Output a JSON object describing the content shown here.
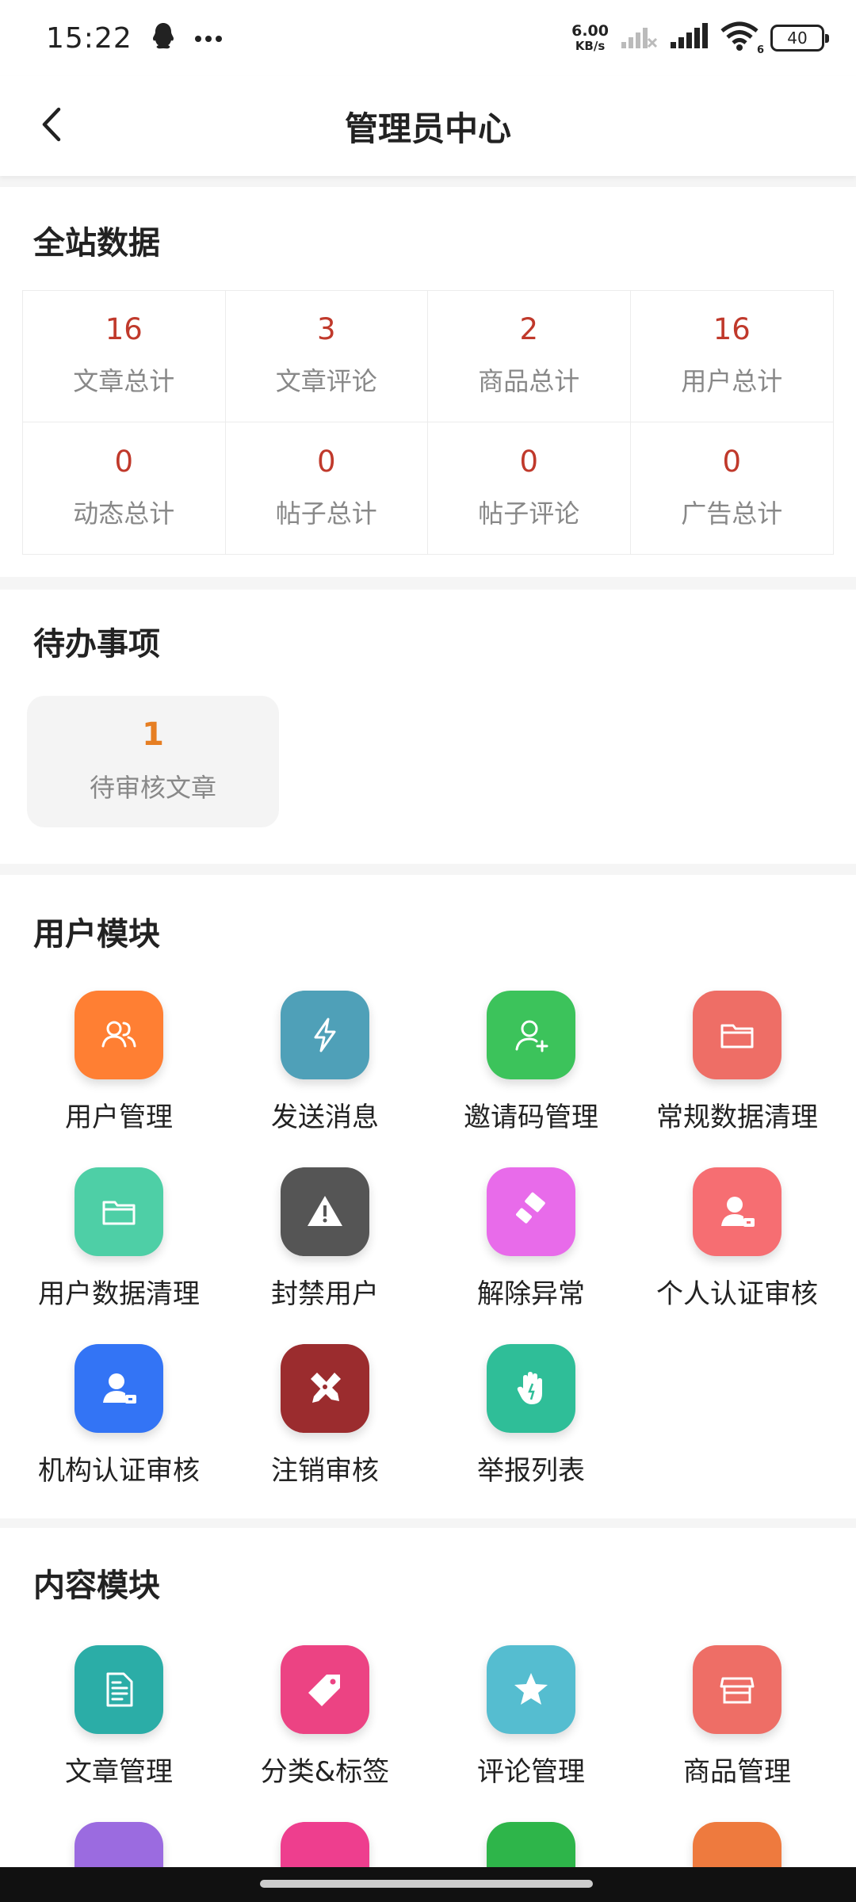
{
  "status_bar": {
    "time": "15:22",
    "net_speed_value": "6.00",
    "net_speed_unit": "KB/s",
    "signal_badge": "6",
    "battery": "40",
    "icons": [
      "qq-icon",
      "more-dots-icon",
      "signal-off-icon",
      "signal-icon",
      "wifi-icon",
      "battery-icon"
    ]
  },
  "nav": {
    "title": "管理员中心",
    "back_icon": "chevron-left-icon"
  },
  "site_data": {
    "title": "全站数据",
    "stats": [
      {
        "value": "16",
        "label": "文章总计"
      },
      {
        "value": "3",
        "label": "文章评论"
      },
      {
        "value": "2",
        "label": "商品总计"
      },
      {
        "value": "16",
        "label": "用户总计"
      },
      {
        "value": "0",
        "label": "动态总计"
      },
      {
        "value": "0",
        "label": "帖子总计"
      },
      {
        "value": "0",
        "label": "帖子评论"
      },
      {
        "value": "0",
        "label": "广告总计"
      }
    ]
  },
  "todo": {
    "title": "待办事项",
    "items": [
      {
        "value": "1",
        "label": "待审核文章"
      }
    ]
  },
  "user_module": {
    "title": "用户模块",
    "items": [
      {
        "label": "用户管理",
        "icon": "users-icon",
        "color": "#FF7F33"
      },
      {
        "label": "发送消息",
        "icon": "lightning-icon",
        "color": "#4FA0B8"
      },
      {
        "label": "邀请码管理",
        "icon": "user-add-icon",
        "color": "#3CC35B"
      },
      {
        "label": "常规数据清理",
        "icon": "folder-icon",
        "color": "#EE6E66"
      },
      {
        "label": "用户数据清理",
        "icon": "folder-icon",
        "color": "#4ECFA6"
      },
      {
        "label": "封禁用户",
        "icon": "warning-icon",
        "color": "#555555"
      },
      {
        "label": "解除异常",
        "icon": "eraser-icon",
        "color": "#E86BEA"
      },
      {
        "label": "个人认证审核",
        "icon": "user-card-icon",
        "color": "#F66E72"
      },
      {
        "label": "机构认证审核",
        "icon": "user-card-icon",
        "color": "#3374F5"
      },
      {
        "label": "注销审核",
        "icon": "tools-icon",
        "color": "#9B2C2E"
      },
      {
        "label": "举报列表",
        "icon": "hand-icon",
        "color": "#2FBE98"
      }
    ]
  },
  "content_module": {
    "title": "内容模块",
    "items": [
      {
        "label": "文章管理",
        "icon": "document-icon",
        "color": "#2BADA7"
      },
      {
        "label": "分类&标签",
        "icon": "tag-icon",
        "color": "#EC4383"
      },
      {
        "label": "评论管理",
        "icon": "star-icon",
        "color": "#55BDD0"
      },
      {
        "label": "商品管理",
        "icon": "shop-icon",
        "color": "#EE6E66"
      }
    ],
    "partial_icon_colors": [
      "#9B6BE0",
      "#EE3E8E",
      "#2EB54A",
      "#EE7A3E"
    ]
  }
}
